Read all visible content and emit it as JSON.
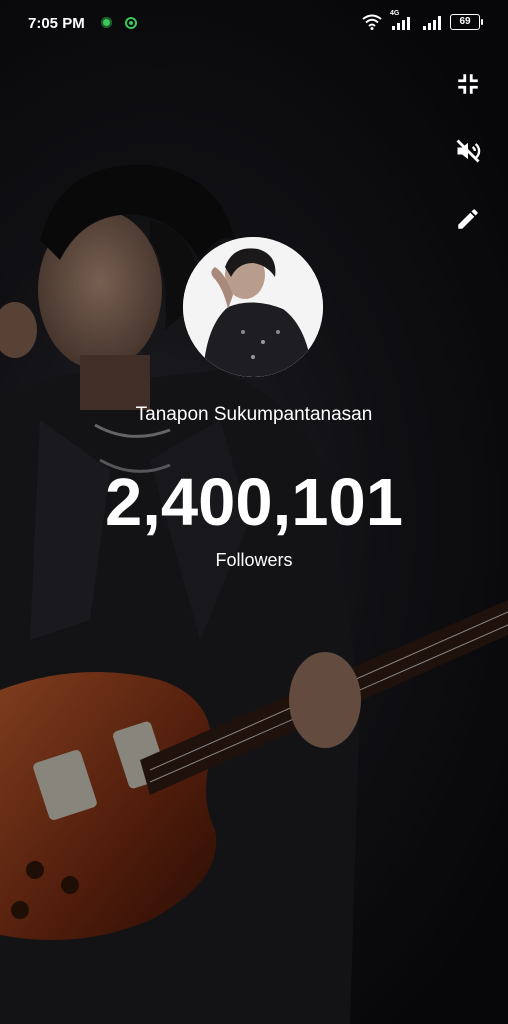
{
  "status_bar": {
    "time": "7:05 PM",
    "network": "4G",
    "battery": "69"
  },
  "icons": {
    "collapse": "collapse-icon",
    "mute": "volume-off-icon",
    "edit": "pencil-icon"
  },
  "profile": {
    "name": "Tanapon Sukumpantanasan",
    "followers": "2,400,101",
    "followers_label": "Followers"
  },
  "colors": {
    "accent_green": "#3cc85a",
    "text": "#ffffff"
  }
}
